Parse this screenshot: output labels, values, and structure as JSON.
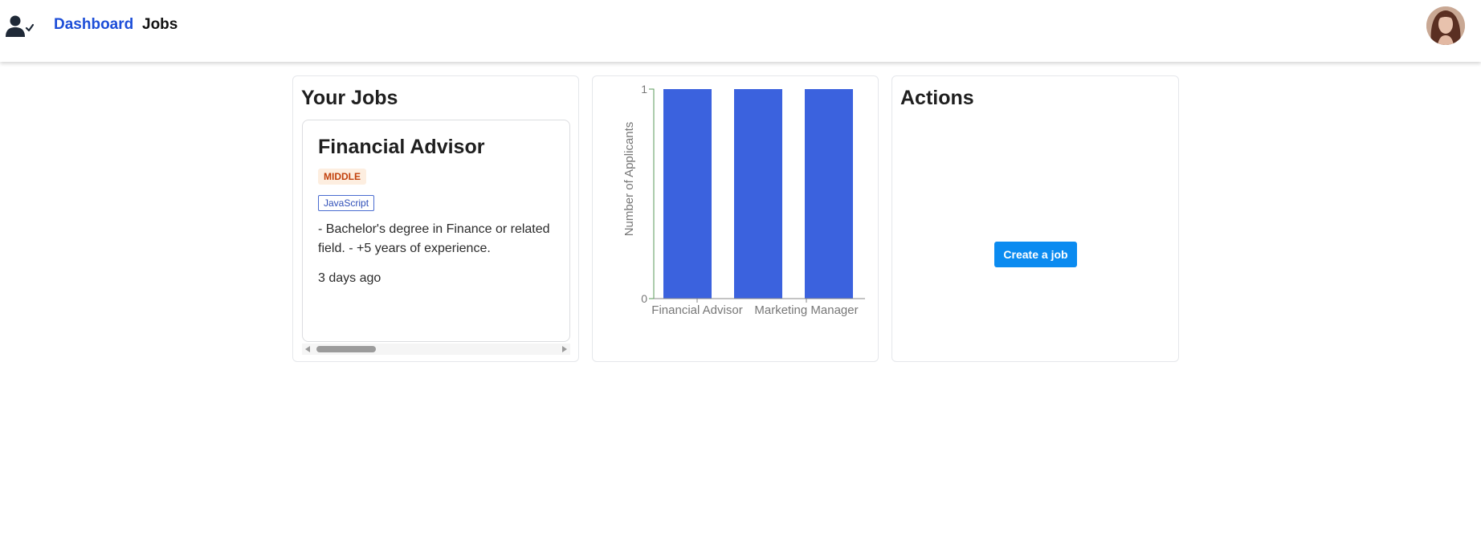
{
  "nav": {
    "logo_icon": "user-check-icon",
    "dashboard": "Dashboard",
    "jobs": "Jobs",
    "accent_color": "#1d4ed8"
  },
  "jobs_panel": {
    "title": "Your Jobs",
    "job": {
      "title": "Financial Advisor",
      "level": "MIDDLE",
      "skill": "JavaScript",
      "description": "- Bachelor's degree in Finance or related field. - +5 years of experience.",
      "posted": "3 days ago"
    }
  },
  "chart_data": {
    "type": "bar",
    "categories": [
      "Financial Advisor",
      "",
      ""
    ],
    "tick_labels": [
      "Financial Advisor",
      "Marketing Manager"
    ],
    "values": [
      1,
      1,
      1
    ],
    "ylabel": "Number of Applicants",
    "yticks": [
      "1",
      "0"
    ],
    "ylim": [
      0,
      1
    ],
    "bar_color": "#3b62de"
  },
  "actions_panel": {
    "title": "Actions",
    "create_button": "Create a job",
    "button_color": "#0b8bf0"
  }
}
